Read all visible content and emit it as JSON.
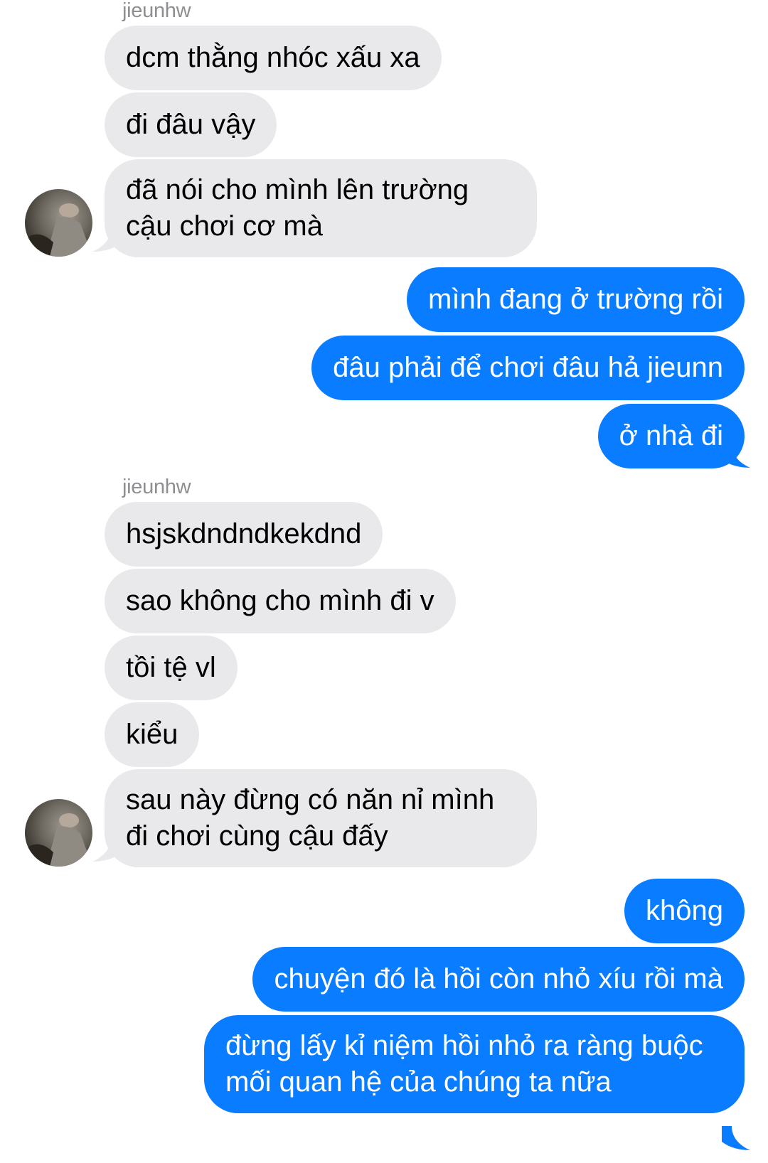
{
  "conversation": {
    "sender_name_1": "jieunhw",
    "sender_name_2": "jieunhw",
    "avatar_icon": "user-avatar-photo",
    "colors": {
      "incoming_bubble": "#e9e9eb",
      "outgoing_bubble": "#0a7cff",
      "sender_name": "#8e8e93"
    },
    "messages": [
      {
        "from": "them",
        "text": "dcm thằng nhóc xấu xa"
      },
      {
        "from": "them",
        "text": "đi đâu vậy"
      },
      {
        "from": "them",
        "text": "đã nói cho mình lên trường cậu chơi cơ mà"
      },
      {
        "from": "me",
        "text": "mình đang ở trường rồi"
      },
      {
        "from": "me",
        "text": "đâu phải để chơi đâu hả jieunn"
      },
      {
        "from": "me",
        "text": "ở nhà đi"
      },
      {
        "from": "them",
        "text": "hsjskdndndkekdnd"
      },
      {
        "from": "them",
        "text": "sao không cho mình đi v"
      },
      {
        "from": "them",
        "text": "tồi tệ vl"
      },
      {
        "from": "them",
        "text": "kiểu"
      },
      {
        "from": "them",
        "text": "sau này đừng có năn nỉ mình đi chơi cùng cậu đấy"
      },
      {
        "from": "me",
        "text": "không"
      },
      {
        "from": "me",
        "text": "chuyện đó là hồi còn nhỏ xíu rồi mà"
      },
      {
        "from": "me",
        "text": "đừng lấy kỉ niệm hồi nhỏ ra ràng buộc mối quan hệ của chúng ta nữa"
      }
    ]
  }
}
